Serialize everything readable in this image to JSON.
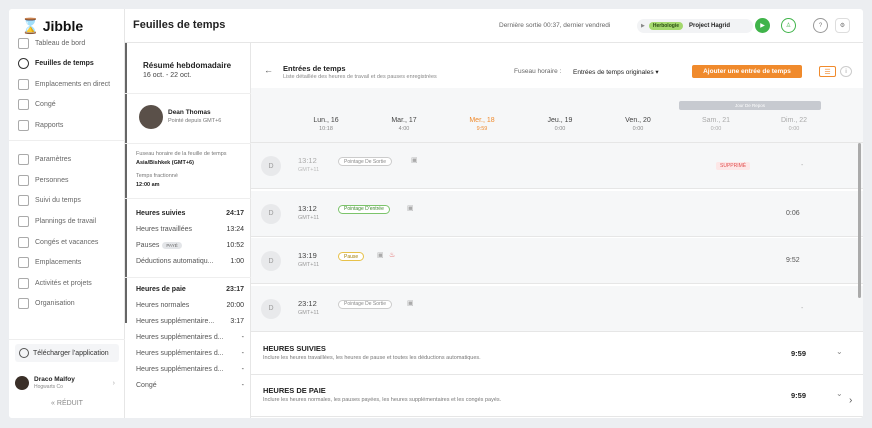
{
  "sidebar": {
    "brand": "Jibble",
    "items": [
      {
        "label": "Tableau de bord",
        "icon": "dashboard-icon"
      },
      {
        "label": "Feuilles de temps",
        "icon": "clock-icon",
        "active": true
      },
      {
        "label": "Emplacements en direct",
        "icon": "location-icon"
      },
      {
        "label": "Congé",
        "icon": "calendar-icon"
      },
      {
        "label": "Rapports",
        "icon": "report-icon"
      },
      {
        "label": "Paramètres",
        "icon": "settings-icon"
      },
      {
        "label": "Personnes",
        "icon": "people-icon"
      },
      {
        "label": "Suivi du temps",
        "icon": "time-tracking-icon"
      },
      {
        "label": "Plannings de travail",
        "icon": "schedule-icon"
      },
      {
        "label": "Congés et vacances",
        "icon": "holiday-icon"
      },
      {
        "label": "Emplacements",
        "icon": "pin-icon"
      },
      {
        "label": "Activités et projets",
        "icon": "activities-icon"
      },
      {
        "label": "Organisation",
        "icon": "organisation-icon"
      }
    ],
    "download": "Télécharger l'application",
    "user": {
      "name": "Draco Malfoy",
      "company": "Hogwarts Co"
    },
    "collapse": "« RÉDUIT"
  },
  "header": {
    "title": "Feuilles de temps",
    "last_exit": "Dernière sortie 00:37, dernier vendredi",
    "tag": "Herbologie",
    "project": "Project Hagrid"
  },
  "summary": {
    "title": "Résumé hebdomadaire",
    "range": "16 oct. - 22 oct.",
    "person": "Dean Thomas",
    "person_sub": "Pointé depuis GMT+6",
    "tz_label": "Fuseau horaire de la feuille de temps",
    "tz_value": "Asia/Bishkek (GMT+6)",
    "split_label": "Temps fractionné",
    "split_value": "12:00 am",
    "tracked": [
      {
        "label": "Heures suivies",
        "value": "24:17",
        "bold": true
      },
      {
        "label": "Heures travaillées",
        "value": "13:24"
      },
      {
        "label": "Pauses",
        "value": "10:52",
        "pill": "PAYÉ"
      },
      {
        "label": "Déductions automatiqu...",
        "value": "1:00"
      }
    ],
    "paid": [
      {
        "label": "Heures de paie",
        "value": "23:17",
        "bold": true
      },
      {
        "label": "Heures normales",
        "value": "20:00"
      },
      {
        "label": "Heures supplémentaire...",
        "value": "3:17"
      },
      {
        "label": "Heures supplémentaires d...",
        "value": "-"
      },
      {
        "label": "Heures supplémentaires d...",
        "value": "-"
      },
      {
        "label": "Heures supplémentaires d...",
        "value": "-"
      },
      {
        "label": "Congé",
        "value": "-"
      }
    ]
  },
  "main": {
    "title": "Entrées de temps",
    "subtitle": "Liste détaillée des heures de travail et des pauses enregistrées",
    "tz_label": "Fuseau horaire :",
    "tz_value": "Entrées de temps originales",
    "add_button": "Ajouter une entrée de temps",
    "rest_label": "Jour De Repos",
    "days": [
      {
        "name": "Lun., 16",
        "val": "10:18"
      },
      {
        "name": "Mar., 17",
        "val": "4:00"
      },
      {
        "name": "Mer., 18",
        "val": "9:59",
        "today": true
      },
      {
        "name": "Jeu., 19",
        "val": "0:00"
      },
      {
        "name": "Ven., 20",
        "val": "0:00"
      },
      {
        "name": "Sam., 21",
        "val": "0:00",
        "weekend": true
      },
      {
        "name": "Dim., 22",
        "val": "0:00",
        "weekend": true
      }
    ],
    "entries": [
      {
        "initial": "D",
        "time": "13:12",
        "gmt": "GMT+11",
        "tag": "Pointage De Sortie",
        "type": "grey",
        "dur": "-",
        "deleted": "SUPPRIMÉ",
        "dim": true
      },
      {
        "initial": "D",
        "time": "13:12",
        "gmt": "GMT+11",
        "tag": "Pointage D'entrée",
        "type": "green",
        "dur": "0:06"
      },
      {
        "initial": "D",
        "time": "13:19",
        "gmt": "GMT+11",
        "tag": "Pause",
        "type": "yel",
        "dur": "9:52"
      },
      {
        "initial": "D",
        "time": "23:12",
        "gmt": "GMT+11",
        "tag": "Pointage De Sortie",
        "type": "grey",
        "dur": "-"
      }
    ],
    "totals": [
      {
        "title": "HEURES SUIVIES",
        "sub": "Inclure les heures travaillées, les heures de pause et toutes les déductions automatiques.",
        "value": "9:59"
      },
      {
        "title": "HEURES DE PAIE",
        "sub": "Inclure les heures normales, les pauses payées, les heures supplémentaires et les congés payés.",
        "value": "9:59"
      }
    ]
  }
}
